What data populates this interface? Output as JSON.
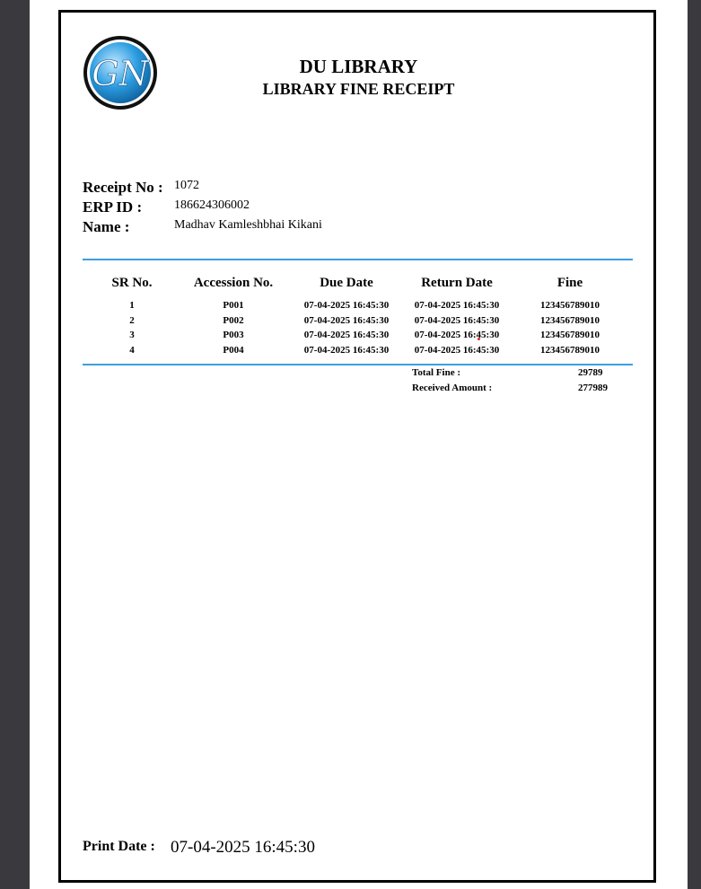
{
  "header": {
    "logo_text": "GN",
    "library_name": "DU LIBRARY",
    "receipt_title": "LIBRARY FINE RECEIPT"
  },
  "details": {
    "receipt_no_label": "Receipt No :",
    "receipt_no": "1072",
    "erp_label": "ERP ID :",
    "erp_id": "186624306002",
    "name_label": "Name :",
    "name": "Madhav Kamleshbhai Kikani"
  },
  "table": {
    "headers": [
      "SR No.",
      "Accession No.",
      "Due Date",
      "Return Date",
      "Fine"
    ],
    "rows": [
      [
        "1",
        "P001",
        "07-04-2025 16:45:30",
        "07-04-2025 16:45:30",
        "123456789010"
      ],
      [
        "2",
        "P002",
        "07-04-2025 16:45:30",
        "07-04-2025 16:45:30",
        "123456789010"
      ],
      [
        "3",
        "P003",
        "07-04-2025 16:45:30",
        "07-04-2025 16:45:30",
        "123456789010"
      ],
      [
        "4",
        "P004",
        "07-04-2025 16:45:30",
        "07-04-2025 16:45:30",
        "123456789010"
      ]
    ]
  },
  "summary": {
    "total_fine_label": "Total Fine :",
    "total_fine": "29789",
    "received_label": "Received Amount :",
    "received": "277989"
  },
  "footer": {
    "print_date_label": "Print Date :",
    "print_date": "07-04-2025 16:45:30"
  },
  "colors": {
    "rule": "#3d9ee0",
    "logo_blue": "#1f8fd6"
  }
}
